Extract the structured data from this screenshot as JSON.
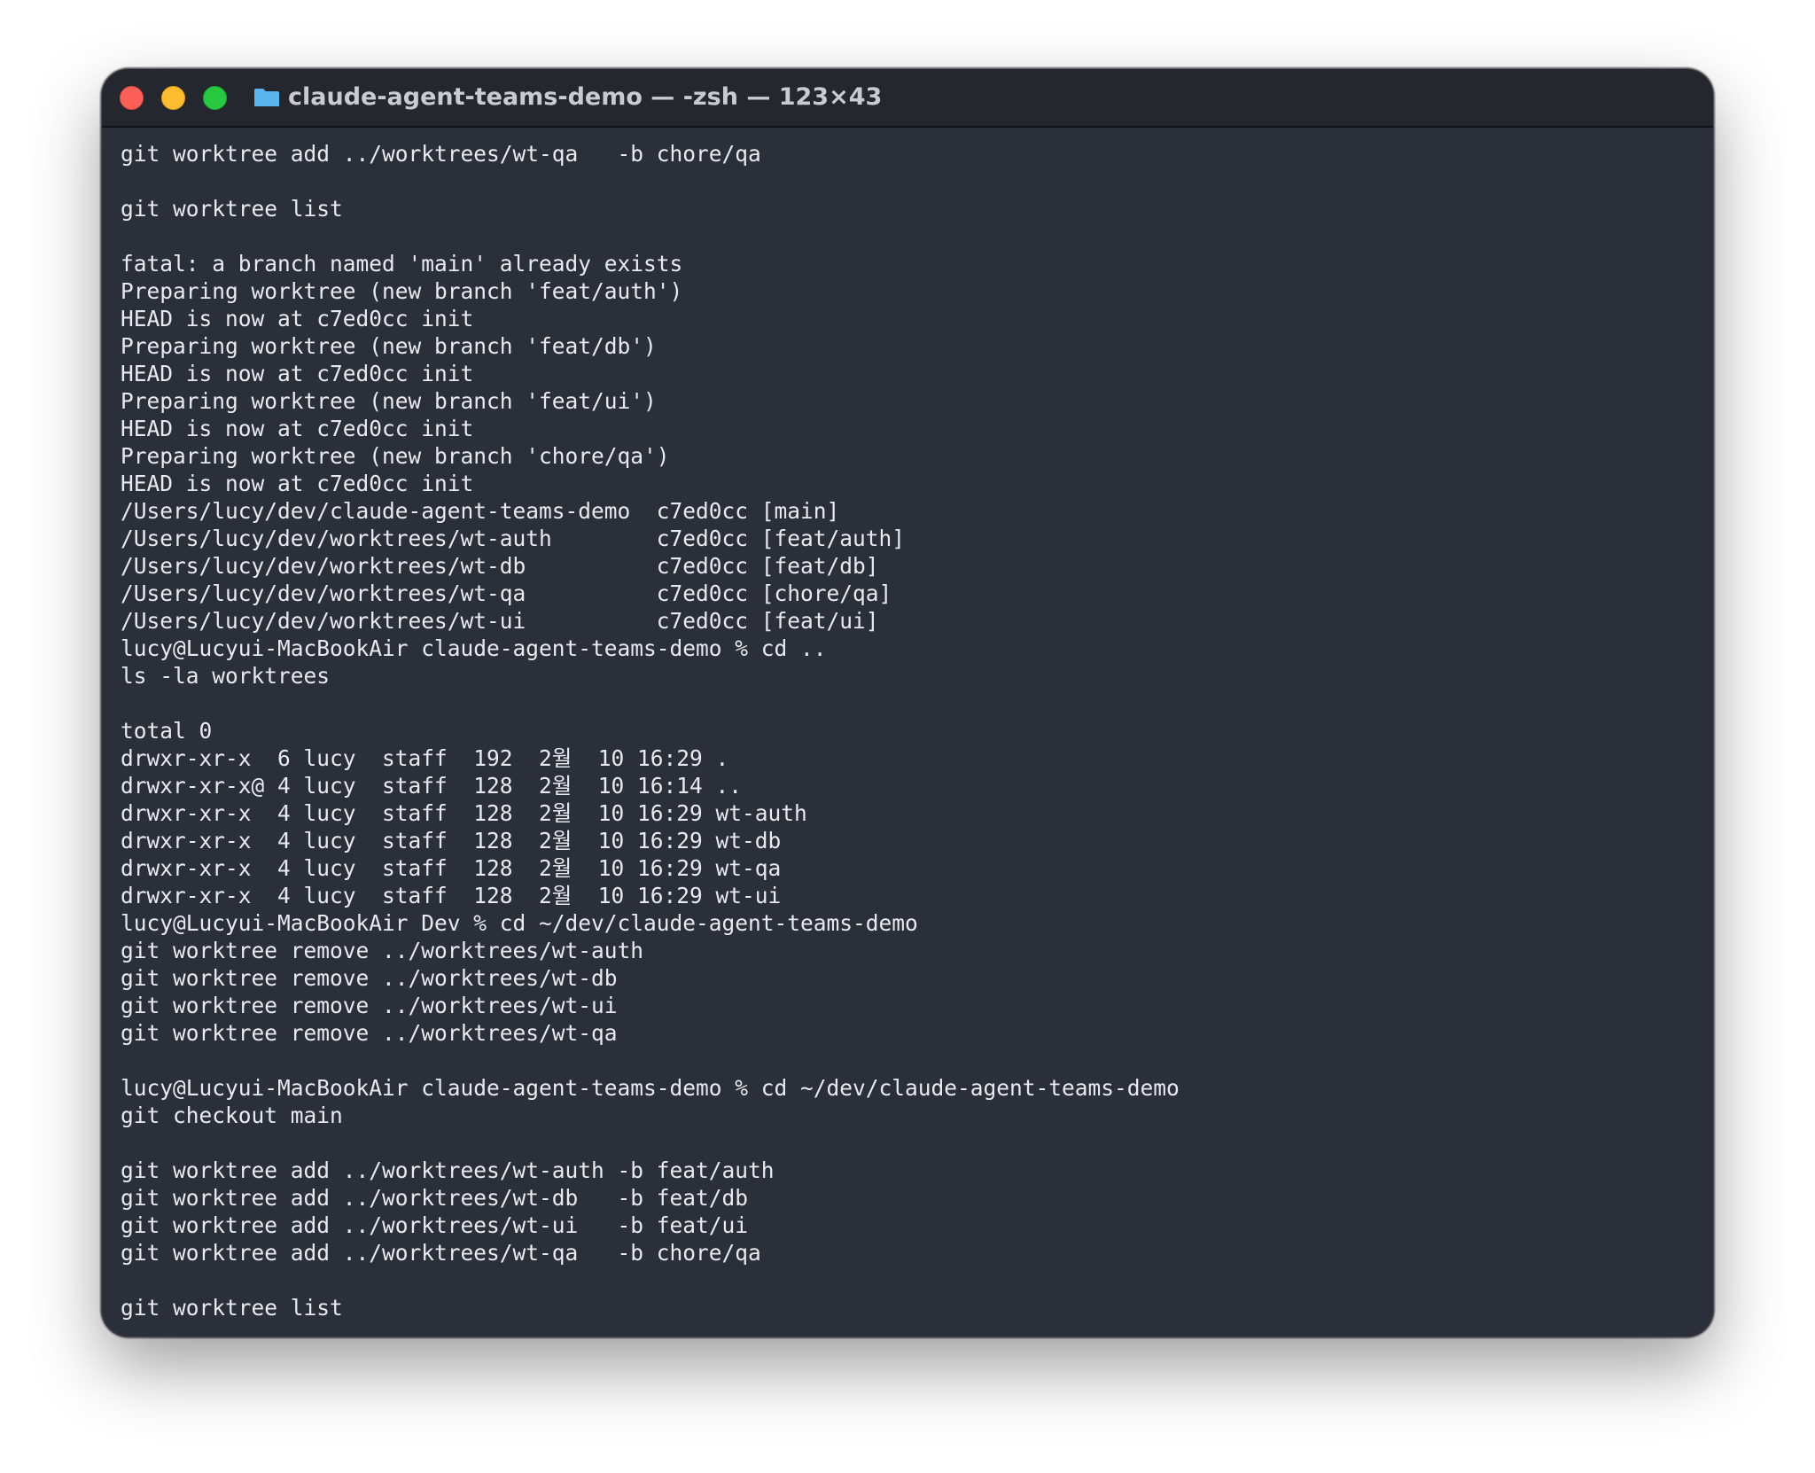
{
  "colors": {
    "terminal_bg": "#2b2f3a",
    "titlebar_bg": "#25272f",
    "text": "#e9eaee",
    "title": "#c9cbd1",
    "folder": "#5ab4f0"
  },
  "window": {
    "title": "claude-agent-teams-demo — -zsh — 123×43",
    "icon": "folder-icon"
  },
  "terminal": {
    "lines": [
      "git worktree add ../worktrees/wt-qa   -b chore/qa",
      "",
      "git worktree list",
      "",
      "fatal: a branch named 'main' already exists",
      "Preparing worktree (new branch 'feat/auth')",
      "HEAD is now at c7ed0cc init",
      "Preparing worktree (new branch 'feat/db')",
      "HEAD is now at c7ed0cc init",
      "Preparing worktree (new branch 'feat/ui')",
      "HEAD is now at c7ed0cc init",
      "Preparing worktree (new branch 'chore/qa')",
      "HEAD is now at c7ed0cc init",
      "/Users/lucy/dev/claude-agent-teams-demo  c7ed0cc [main]",
      "/Users/lucy/dev/worktrees/wt-auth        c7ed0cc [feat/auth]",
      "/Users/lucy/dev/worktrees/wt-db          c7ed0cc [feat/db]",
      "/Users/lucy/dev/worktrees/wt-qa          c7ed0cc [chore/qa]",
      "/Users/lucy/dev/worktrees/wt-ui          c7ed0cc [feat/ui]",
      "lucy@Lucyui-MacBookAir claude-agent-teams-demo % cd ..",
      "ls -la worktrees",
      "",
      "total 0",
      "drwxr-xr-x  6 lucy  staff  192  2월  10 16:29 .",
      "drwxr-xr-x@ 4 lucy  staff  128  2월  10 16:14 ..",
      "drwxr-xr-x  4 lucy  staff  128  2월  10 16:29 wt-auth",
      "drwxr-xr-x  4 lucy  staff  128  2월  10 16:29 wt-db",
      "drwxr-xr-x  4 lucy  staff  128  2월  10 16:29 wt-qa",
      "drwxr-xr-x  4 lucy  staff  128  2월  10 16:29 wt-ui",
      "lucy@Lucyui-MacBookAir Dev % cd ~/dev/claude-agent-teams-demo",
      "git worktree remove ../worktrees/wt-auth",
      "git worktree remove ../worktrees/wt-db",
      "git worktree remove ../worktrees/wt-ui",
      "git worktree remove ../worktrees/wt-qa",
      "",
      "lucy@Lucyui-MacBookAir claude-agent-teams-demo % cd ~/dev/claude-agent-teams-demo",
      "git checkout main",
      "",
      "git worktree add ../worktrees/wt-auth -b feat/auth",
      "git worktree add ../worktrees/wt-db   -b feat/db",
      "git worktree add ../worktrees/wt-ui   -b feat/ui",
      "git worktree add ../worktrees/wt-qa   -b chore/qa",
      "",
      "git worktree list"
    ]
  }
}
